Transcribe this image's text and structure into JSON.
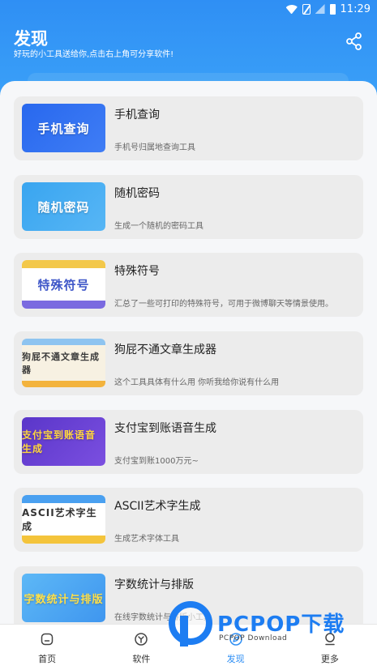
{
  "status_bar": {
    "time": "11:29"
  },
  "header": {
    "title": "发现",
    "subtitle": "好玩的小工具送给你,点击右上角可分享软件!",
    "share_icon": "share-icon"
  },
  "tools": [
    {
      "thumb_text": "手机查询",
      "title": "手机查询",
      "desc": "手机号归属地查询工具"
    },
    {
      "thumb_text": "随机密码",
      "title": "随机密码",
      "desc": "生成一个随机的密码工具"
    },
    {
      "thumb_text": "特殊符号",
      "title": "特殊符号",
      "desc": "汇总了一些可打印的特殊符号，可用于微博聊天等情景使用。"
    },
    {
      "thumb_text": "狗屁不通文章生成器",
      "title": "狗屁不通文章生成器",
      "desc": "这个工具具体有什么用 你听我给你说有什么用"
    },
    {
      "thumb_text": "支付宝到账语音生成",
      "title": "支付宝到账语音生成",
      "desc": "支付宝到账1000万元~"
    },
    {
      "thumb_text": "ASCII艺术字生成",
      "title": "ASCII艺术字生成",
      "desc": "生成艺术字体工具"
    },
    {
      "thumb_text": "字数统计与排版",
      "title": "字数统计与排版",
      "desc": "在线字数统计与排版小工具"
    }
  ],
  "tabbar": [
    {
      "label": "首页",
      "icon": "home-icon"
    },
    {
      "label": "软件",
      "icon": "software-icon"
    },
    {
      "label": "发现",
      "icon": "discover-icon",
      "active": true
    },
    {
      "label": "更多",
      "icon": "more-icon"
    }
  ],
  "watermark": {
    "brand": "PCPOP下载",
    "sub": "PCPOP Download"
  },
  "colors": {
    "accent": "#2f8ff4",
    "card_bg": "#ececec",
    "page_bg": "#f6f7f9"
  }
}
